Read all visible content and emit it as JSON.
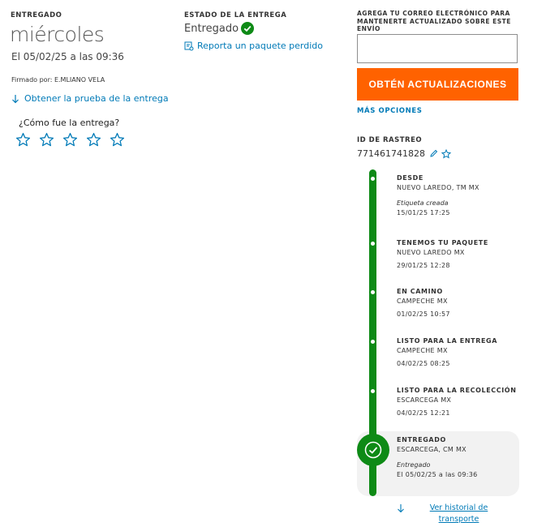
{
  "delivery": {
    "status_caption": "ENTREGADO",
    "day": "miércoles",
    "date_time": "El 05/02/25 a las 09:36",
    "signed_by": "Firmado por: E.MLIANO VELA",
    "proof_link": "Obtener la prueba de la entrega",
    "rating_prompt": "¿Cómo fue la entrega?",
    "rating_max": 5,
    "rating_value": 0
  },
  "delivery_state": {
    "caption": "ESTADO DE LA ENTREGA",
    "value": "Entregado",
    "report_link": "Reporta un paquete perdido"
  },
  "updates": {
    "caption": "AGREGA TU CORREO ELECTRÓNICO PARA MANTENERTE ACTUALIZADO SOBRE ESTE ENVÍO",
    "email_value": "",
    "button_label": "OBTÉN ACTUALIZACIONES",
    "more_options": "MÁS OPCIONES",
    "button_color": "#ff6200"
  },
  "tracking": {
    "caption": "ID DE RASTREO",
    "number": "771461741828",
    "accent_color": "#0e8a16",
    "events": [
      {
        "title": "DESDE",
        "location": "NUEVO LAREDO, TM MX",
        "note": "Etiqueta creada",
        "datetime": "15/01/25 17:25"
      },
      {
        "title": "TENEMOS TU PAQUETE",
        "location": "NUEVO LAREDO MX",
        "note": "",
        "datetime": "29/01/25 12:28"
      },
      {
        "title": "EN CAMINO",
        "location": "CAMPECHE MX",
        "note": "",
        "datetime": "01/02/25 10:57"
      },
      {
        "title": "LISTO PARA LA ENTREGA",
        "location": "CAMPECHE MX",
        "note": "",
        "datetime": "04/02/25 08:25"
      },
      {
        "title": "LISTO PARA LA RECOLECCIÓN",
        "location": "ESCARCEGA MX",
        "note": "",
        "datetime": "04/02/25 12:21"
      },
      {
        "title": "ENTREGADO",
        "location": "ESCARCEGA, CM MX",
        "note": "Entregado",
        "datetime": "El 05/02/25 a las 09:36"
      }
    ],
    "history_link": "Ver historial de transporte"
  },
  "icons": {
    "delivered_check": "check-circle-icon",
    "report": "report-document-icon",
    "download": "download-arrow-icon",
    "star": "star-outline-icon",
    "edit": "pencil-icon",
    "favorite": "star-outline-icon",
    "history_arrow": "arrow-down-icon"
  }
}
